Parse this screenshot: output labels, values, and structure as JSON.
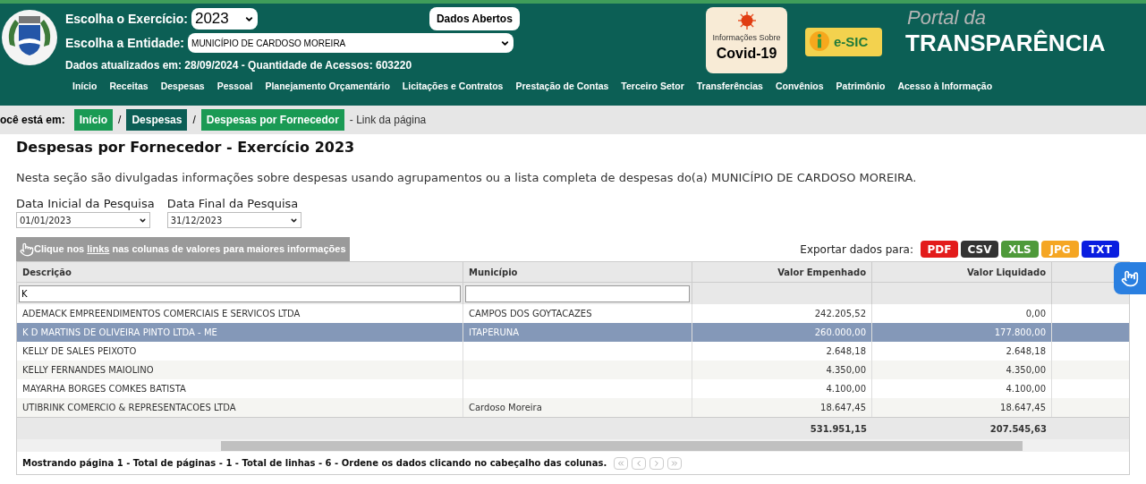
{
  "header": {
    "exercise_label": "Escolha o Exercício:",
    "exercise_value": "2023",
    "entity_label": "Escolha a Entidade:",
    "entity_value": "MUNICÍPIO DE CARDOSO MOREIRA",
    "open_data_button": "Dados Abertos",
    "updated_info": "Dados atualizados em: 28/09/2024 - Quantidade de Acessos: 603220",
    "covid": {
      "caption": "Informações Sobre",
      "title": "Covid-19"
    },
    "esic": "e-SIC",
    "portal_top": "Portal da",
    "portal_bottom": "TRANSPARÊNCIA"
  },
  "nav": [
    "Início",
    "Receitas",
    "Despesas",
    "Pessoal",
    "Planejamento Orçamentário",
    "Licitações e Contratos",
    "Prestação de Contas",
    "Terceiro Setor",
    "Transferências",
    "Convênios",
    "Patrimônio",
    "Acesso à Informação"
  ],
  "breadcrumb": {
    "label": "ocê está em:",
    "items": [
      {
        "label": "Início",
        "color": "#1a9a54"
      },
      {
        "label": "Despesas",
        "color": "#0b5e55"
      },
      {
        "label": "Despesas por Fornecedor",
        "color": "#1a9a54"
      }
    ],
    "separator": "/",
    "link": "- Link da página"
  },
  "page": {
    "title": "Despesas por Fornecedor - Exercício 2023",
    "description": "Nesta seção são divulgadas informações sobre despesas usando agrupamentos ou a lista completa de despesas do(a) MUNICÍPIO DE CARDOSO MOREIRA."
  },
  "filters": [
    {
      "label": "Data Inicial da Pesquisa",
      "value": "01/01/2023"
    },
    {
      "label": "Data Final da Pesquisa",
      "value": "31/12/2023"
    }
  ],
  "hint": {
    "before": "Clique nos",
    "link": "links",
    "after": "nas colunas de valores para maiores informações"
  },
  "export": {
    "label": "Exportar dados para:",
    "formats": [
      {
        "label": "PDF",
        "color": "#e31b1b"
      },
      {
        "label": "CSV",
        "color": "#333333"
      },
      {
        "label": "XLS",
        "color": "#4e9a3a"
      },
      {
        "label": "JPG",
        "color": "#f5a623"
      },
      {
        "label": "TXT",
        "color": "#0a1ee0"
      }
    ]
  },
  "table": {
    "columns": [
      "Descrição",
      "Município",
      "Valor Empenhado",
      "Valor Liquidado"
    ],
    "filter_values": [
      "K"
    ],
    "rows": [
      {
        "cells": [
          "ADEMACK EMPREENDIMENTOS COMERCIAIS E SERVICOS LTDA",
          "CAMPOS DOS GOYTACAZES",
          "242.205,52",
          "0,00"
        ],
        "selected": false
      },
      {
        "cells": [
          "K D MARTINS DE OLIVEIRA PINTO LTDA - ME",
          "ITAPERUNA",
          "260.000,00",
          "177.800,00"
        ],
        "selected": true
      },
      {
        "cells": [
          "KELLY DE SALES PEIXOTO",
          "",
          "2.648,18",
          "2.648,18"
        ],
        "selected": false
      },
      {
        "cells": [
          "KELLY FERNANDES MAIOLINO",
          "",
          "4.350,00",
          "4.350,00"
        ],
        "selected": false
      },
      {
        "cells": [
          "MAYARHA BORGES COMKES BATISTA",
          "",
          "4.100,00",
          "4.100,00"
        ],
        "selected": false
      },
      {
        "cells": [
          "UTIBRINK COMERCIO & REPRESENTACOES LTDA",
          "Cardoso Moreira",
          "18.647,45",
          "18.647,45"
        ],
        "selected": false
      }
    ],
    "totals": [
      "531.951,15",
      "207.545,63"
    ],
    "footer": "Mostrando página 1 - Total de páginas - 1 - Total de linhas - 6 - Ordene os dados clicando no cabeçalho das colunas."
  }
}
